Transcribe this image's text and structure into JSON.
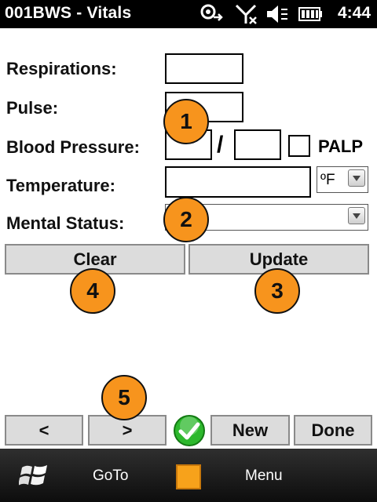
{
  "status_bar": {
    "title": "001BWS - Vitals",
    "time": "4:44",
    "icons": [
      "sync-icon",
      "no-signal-icon",
      "volume-muted-icon",
      "battery-icon"
    ]
  },
  "form": {
    "respirations_label": "Respirations:",
    "pulse_label": "Pulse:",
    "bp_label": "Blood Pressure:",
    "bp_separator": "/",
    "palp_label": "PALP",
    "temperature_label": "Temperature:",
    "temperature_unit": "ºF",
    "mental_status_label": "Mental Status:",
    "respirations_value": "",
    "pulse_value": "",
    "bp_systolic_value": "",
    "bp_diastolic_value": "",
    "temperature_value": "",
    "mental_status_value": ""
  },
  "buttons": {
    "clear": "Clear",
    "update": "Update",
    "prev": "<",
    "next": ">",
    "new": "New",
    "done": "Done"
  },
  "callouts": [
    "1",
    "2",
    "3",
    "4",
    "5"
  ],
  "softkeys": {
    "left": "GoTo",
    "right": "Menu"
  },
  "colors": {
    "callout": "#f7941d",
    "check": "#2db82d",
    "titlebar": "#000000"
  }
}
